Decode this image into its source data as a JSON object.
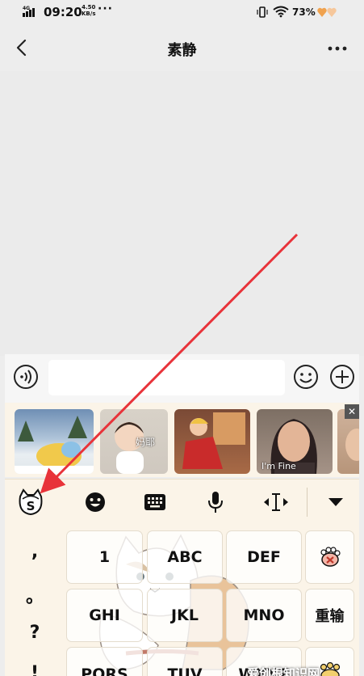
{
  "status_bar": {
    "signal": "4G",
    "time": "09:20",
    "net_speed": "4.50",
    "net_unit": "KB/s",
    "more_dots": "···",
    "battery": "73%"
  },
  "titlebar": {
    "back": "<",
    "title": "素静",
    "more": "···"
  },
  "stickers": {
    "items": [
      {
        "caption": ""
      },
      {
        "caption": "妈耶"
      },
      {
        "caption": ""
      },
      {
        "caption": "I'm Fine"
      },
      {
        "caption": ""
      }
    ],
    "close": "✕"
  },
  "toolbar": {
    "logo_letter": "S"
  },
  "keyboard": {
    "punctuation": [
      ",",
      "。",
      "?",
      "!"
    ],
    "keys": {
      "k1": "1",
      "abc": "ABC",
      "def": "DEF",
      "ghi": "GHI",
      "jkl": "JKL",
      "mno": "MNO",
      "reinput": "重输",
      "pqrs": "PQRS",
      "tuv": "TUV",
      "wxyz": "WXYZ"
    }
  },
  "watermark": "爱创根知识网",
  "colors": {
    "arrow": "#e8333a",
    "keyboard_bg": "#fbf4e8",
    "chat_bg": "#ebebeb"
  }
}
